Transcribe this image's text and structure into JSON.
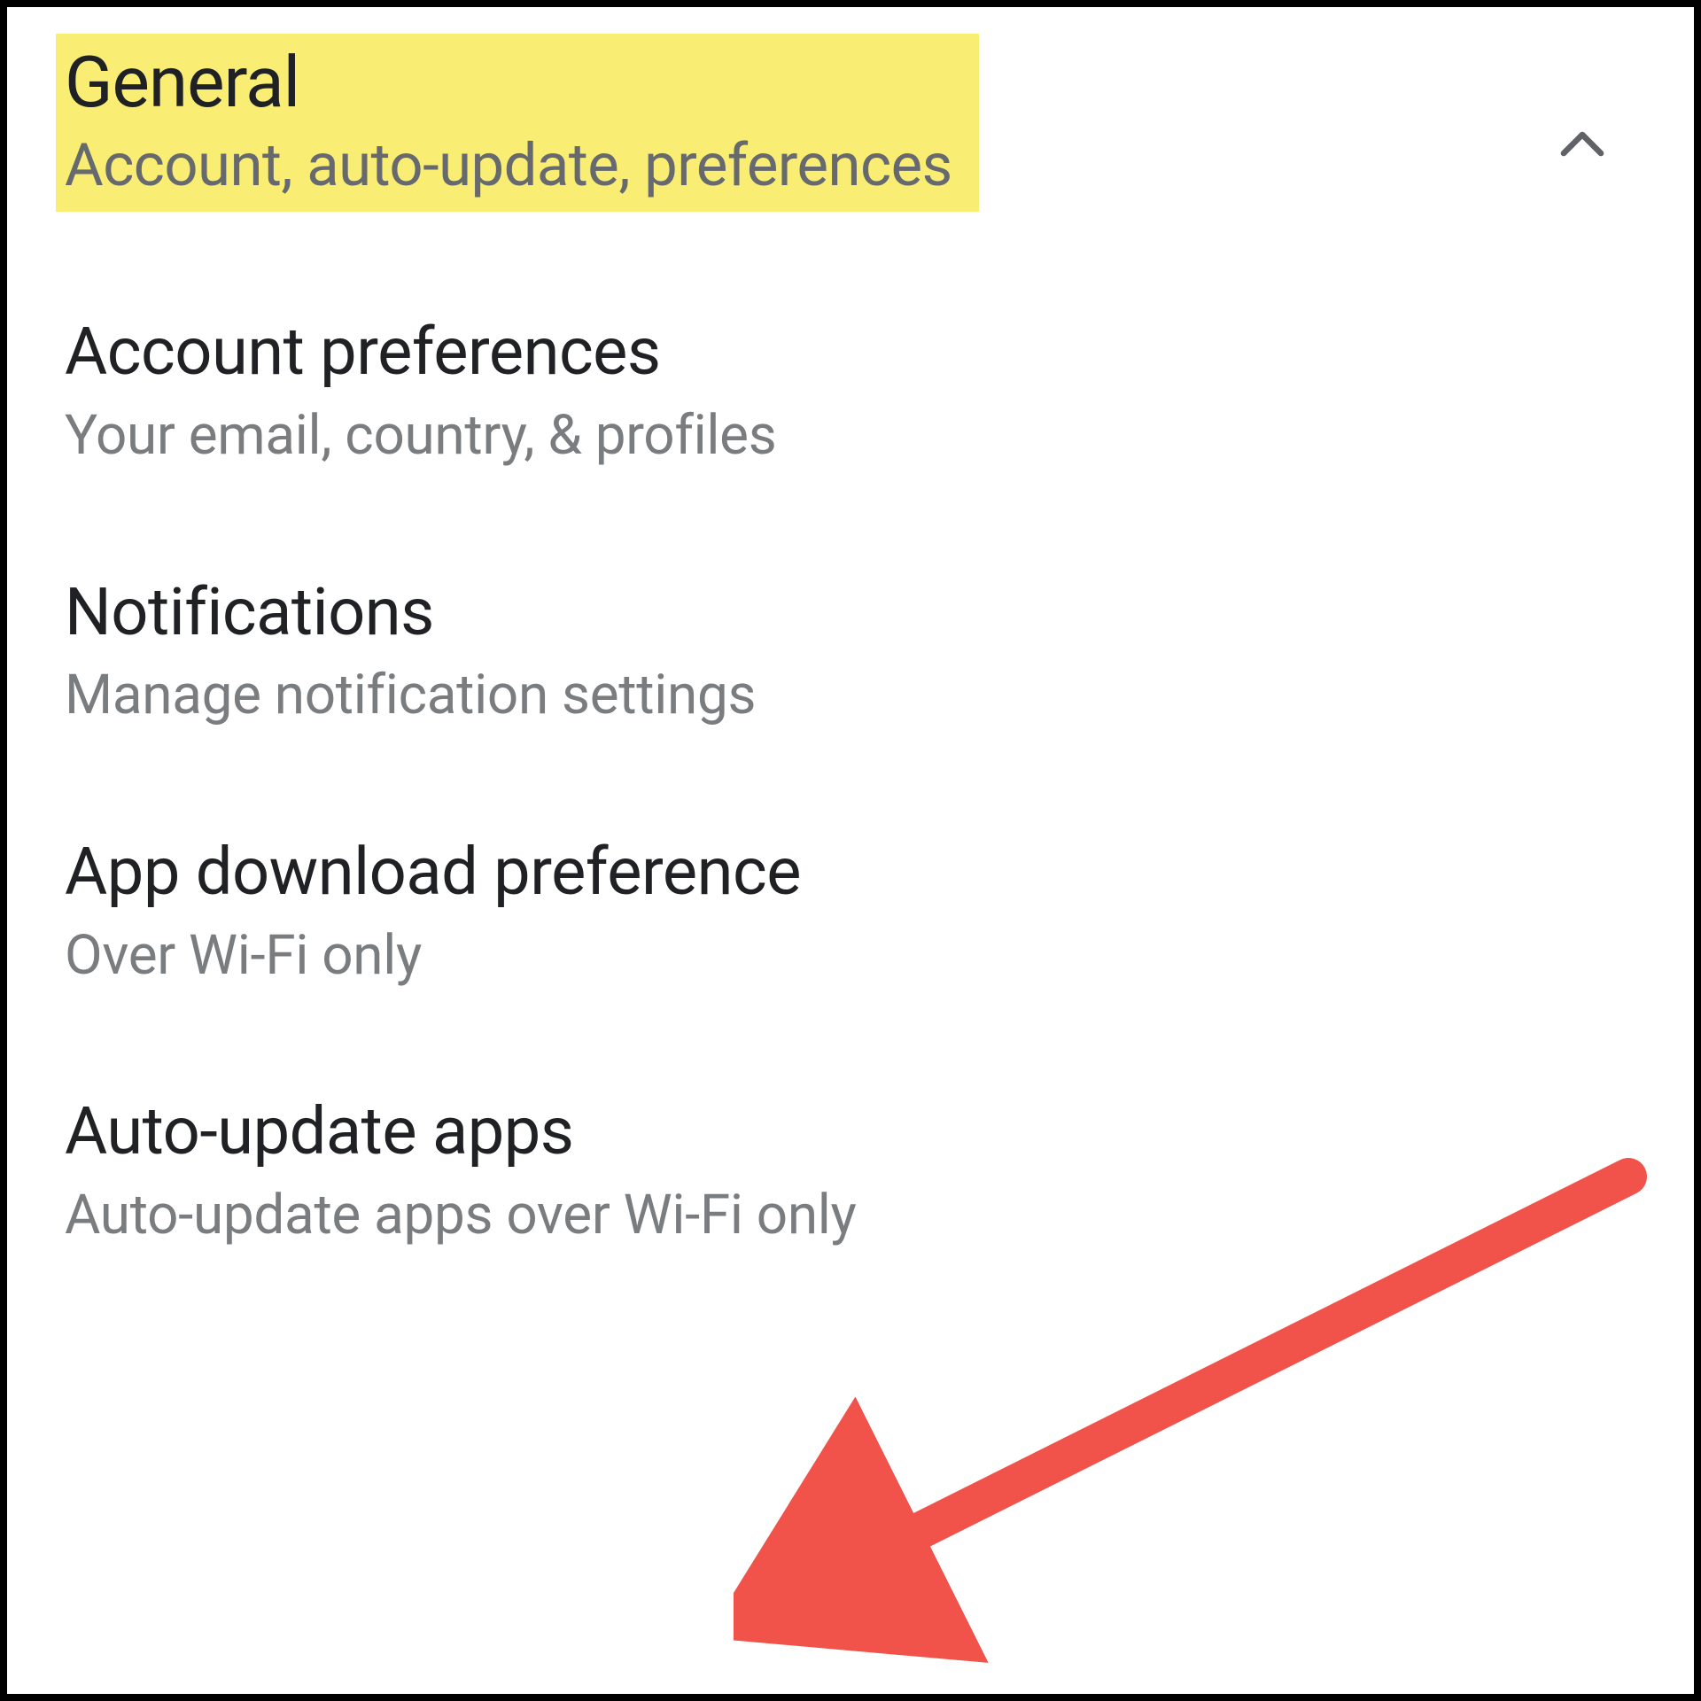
{
  "header": {
    "title": "General",
    "subtitle": "Account, auto-update, preferences",
    "expanded": true
  },
  "settings": [
    {
      "title": "Account preferences",
      "subtitle": "Your email, country, & profiles"
    },
    {
      "title": "Notifications",
      "subtitle": "Manage notification settings"
    },
    {
      "title": "App download preference",
      "subtitle": "Over Wi-Fi only"
    },
    {
      "title": "Auto-update apps",
      "subtitle": "Auto-update apps over Wi-Fi only"
    }
  ],
  "annotation": {
    "type": "arrow",
    "target": "auto-update-apps",
    "color": "#f1524a"
  },
  "highlight": {
    "target": "general-header",
    "color": "#f9ee73"
  }
}
